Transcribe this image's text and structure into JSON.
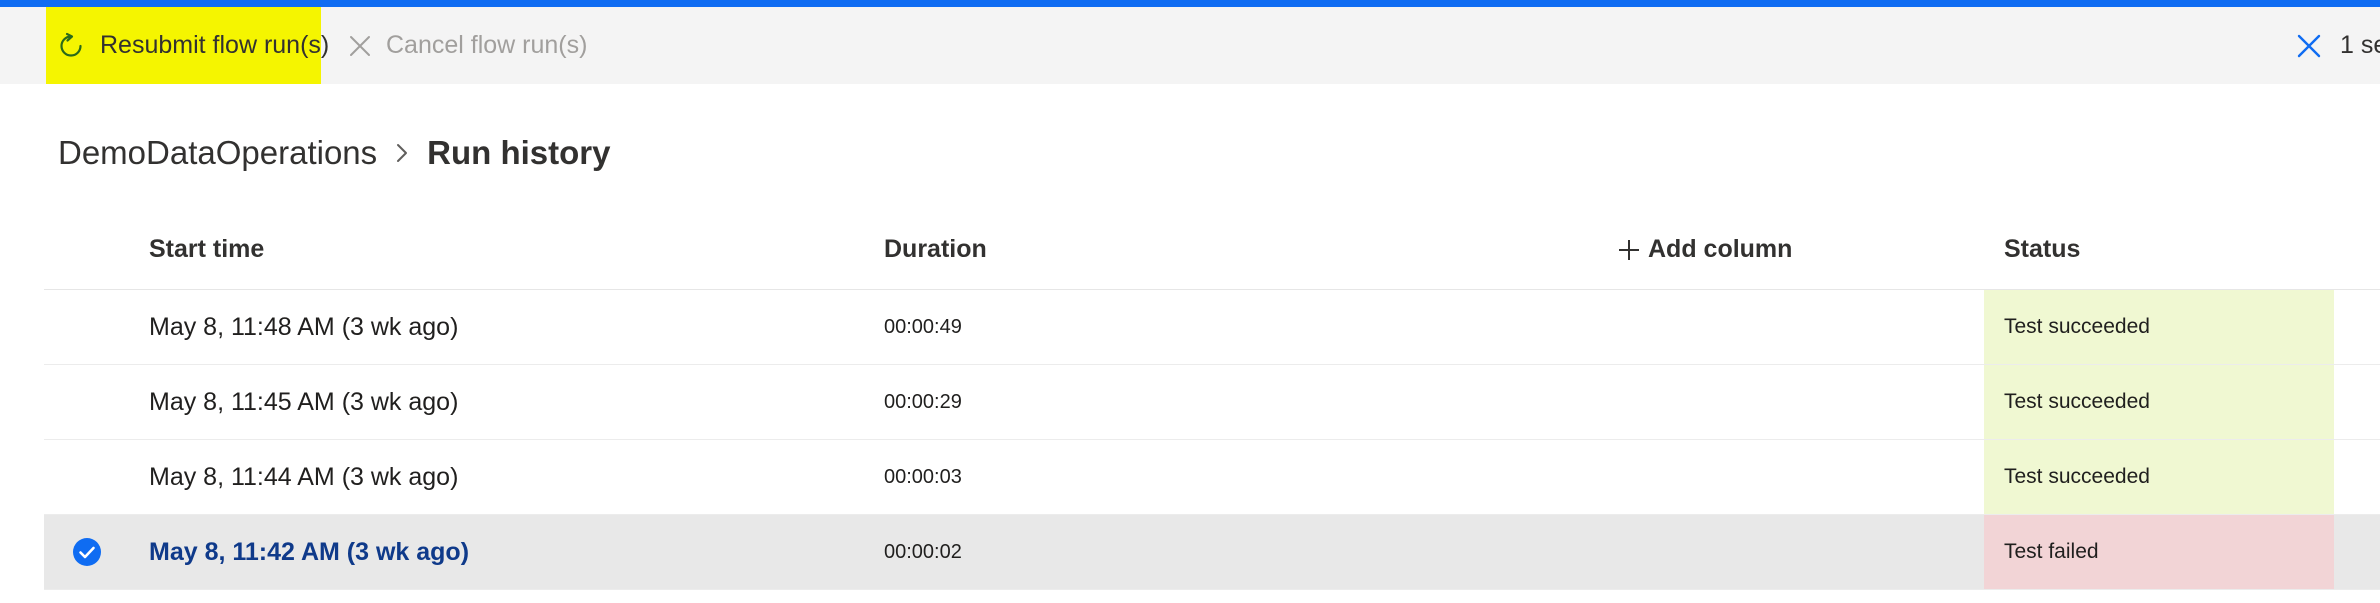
{
  "command_bar": {
    "resubmit_label": "Resubmit flow run(s)",
    "cancel_label": "Cancel flow run(s)",
    "selection_label": "1 se"
  },
  "breadcrumb": {
    "parent": "DemoDataOperations",
    "current": "Run history"
  },
  "table": {
    "columns": {
      "start_time": "Start time",
      "duration": "Duration",
      "add_column": "Add column",
      "status": "Status"
    },
    "rows": [
      {
        "start_time": "May 8, 11:48 AM (3 wk ago)",
        "duration": "00:00:49",
        "status": "Test succeeded",
        "selected": false
      },
      {
        "start_time": "May 8, 11:45 AM (3 wk ago)",
        "duration": "00:00:29",
        "status": "Test succeeded",
        "selected": false
      },
      {
        "start_time": "May 8, 11:44 AM (3 wk ago)",
        "duration": "00:00:03",
        "status": "Test succeeded",
        "selected": false
      },
      {
        "start_time": "May 8, 11:42 AM (3 wk ago)",
        "duration": "00:00:02",
        "status": "Test failed",
        "selected": true
      }
    ]
  },
  "colors": {
    "accent": "#0f6cf2",
    "highlight": "#f5f500",
    "success_bg": "#f0f8d2",
    "failed_bg": "#f2d4d6",
    "selected_row_bg": "#e8e8e8"
  },
  "icons": {
    "resubmit": "refresh-icon",
    "cancel": "close-icon",
    "clear_selection": "close-icon",
    "separator": "chevron-right-icon",
    "add": "plus-icon",
    "check": "checkmark-circle-icon"
  }
}
